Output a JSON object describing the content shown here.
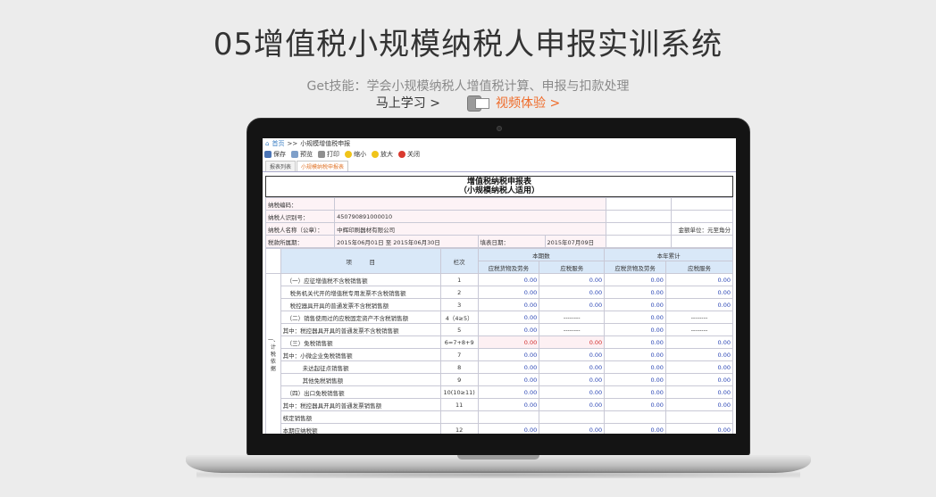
{
  "hero": {
    "title": "05增值税小规模纳税人申报实训系统",
    "subtitle": "Get技能：学会小规模纳税人增值税计算、申报与扣款处理",
    "learn_link": "马上学习 >",
    "video_link": "视频体验 >"
  },
  "app": {
    "breadcrumb": {
      "home": "首页",
      "separator": ">>",
      "current": "小规模增值税申报"
    },
    "toolbar": {
      "save": "保存",
      "preview": "预览",
      "print": "打印",
      "zoom_out": "缩小",
      "zoom_in": "放大",
      "close": "关闭"
    },
    "tabs": [
      "报表列表",
      "小规模纳税申报表"
    ],
    "form": {
      "title_line1": "增值税纳税申报表",
      "title_line2": "（小规模纳税人适用）",
      "taxpayer_code_label": "纳税编码：",
      "taxpayer_id_label": "纳税人识别号：",
      "taxpayer_id": "450790891000010",
      "taxpayer_name_label": "纳税人名称（公章）：",
      "taxpayer_name": "中辉印刷器材有限公司",
      "currency_unit": "金额单位：元至角分",
      "period_label": "税款所属期：",
      "period_value": "2015年06月01日  至  2015年06月30日",
      "fill_date_label": "填表日期：",
      "fill_date": "2015年07月09日",
      "side_label": "一、计税依据",
      "headers": {
        "item": "项　　　目",
        "column_no": "栏次",
        "current_period": "本期数",
        "year_to_date": "本年累计",
        "goods": "应税货物及劳务",
        "services": "应税服务"
      },
      "rows": [
        {
          "label": "（一）应征增值税不含税销售额",
          "col": "1",
          "v": [
            "0.00",
            "0.00",
            "0.00",
            "0.00"
          ]
        },
        {
          "label": "税务机关代开的增值税专用发票不含税销售额",
          "col": "2",
          "v": [
            "0.00",
            "0.00",
            "0.00",
            "0.00"
          ]
        },
        {
          "label": "税控器具开具的普通发票不含税销售额",
          "col": "3",
          "v": [
            "0.00",
            "0.00",
            "0.00",
            "0.00"
          ]
        },
        {
          "label": "（二）销售使用过的应税固定资产不含税销售额",
          "col": "4（4≥5）",
          "v": [
            "0.00",
            "--------",
            "0.00",
            "--------"
          ]
        },
        {
          "label": "其中：税控器具开具的普通发票不含税销售额",
          "col": "5",
          "v": [
            "0.00",
            "--------",
            "0.00",
            "--------"
          ]
        },
        {
          "label": "（三）免税销售额",
          "col": "6=7+8+9",
          "v": [
            "0.00",
            "0.00",
            "0.00",
            "0.00"
          ]
        },
        {
          "label": "其中：小微企业免税销售额",
          "col": "7",
          "v": [
            "0.00",
            "0.00",
            "0.00",
            "0.00"
          ]
        },
        {
          "label": "未达起征点销售额",
          "col": "8",
          "v": [
            "0.00",
            "0.00",
            "0.00",
            "0.00"
          ]
        },
        {
          "label": "其他免税销售额",
          "col": "9",
          "v": [
            "0.00",
            "0.00",
            "0.00",
            "0.00"
          ]
        },
        {
          "label": "（四）出口免税销售额",
          "col": "10(10≥11)",
          "v": [
            "0.00",
            "0.00",
            "0.00",
            "0.00"
          ]
        },
        {
          "label": "其中：税控器具开具的普通发票销售额",
          "col": "11",
          "v": [
            "0.00",
            "0.00",
            "0.00",
            "0.00"
          ]
        },
        {
          "label": "核定销售额",
          "col": "",
          "v": [
            "",
            "",
            "",
            ""
          ]
        },
        {
          "label": "本期应纳税额",
          "col": "12",
          "v": [
            "0.00",
            "0.00",
            "0.00",
            "0.00"
          ]
        }
      ]
    }
  }
}
